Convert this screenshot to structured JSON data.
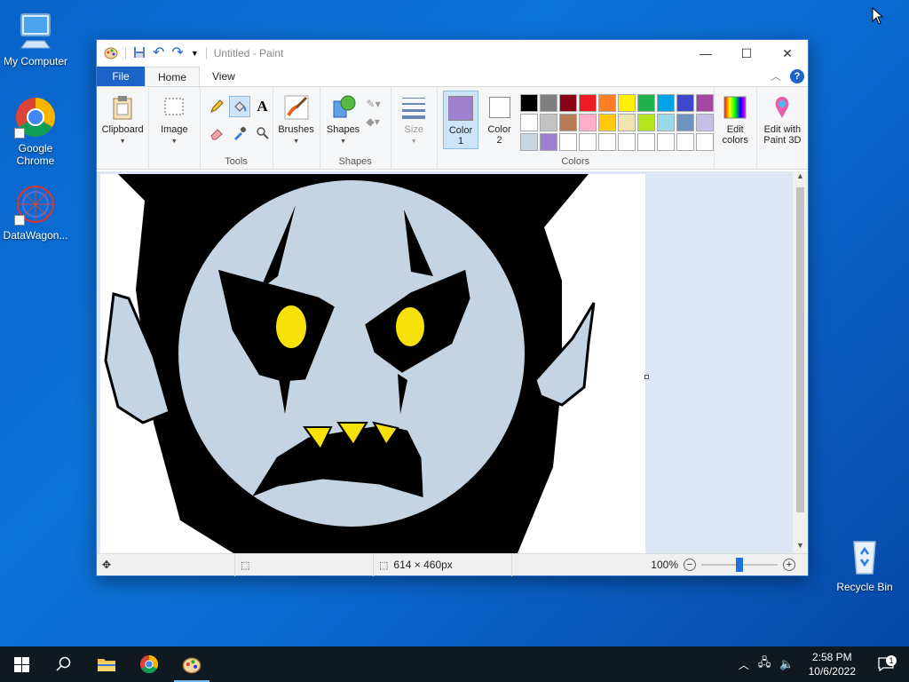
{
  "desktop": {
    "icons": [
      {
        "label": "My Computer"
      },
      {
        "label": "Google Chrome"
      },
      {
        "label": "DataWagon..."
      },
      {
        "label": "Recycle Bin"
      }
    ]
  },
  "window": {
    "title": "Untitled - Paint",
    "tabs": {
      "file": "File",
      "home": "Home",
      "view": "View"
    },
    "help": "?"
  },
  "ribbon": {
    "clipboard": {
      "label": "Clipboard"
    },
    "image": {
      "label": "Image"
    },
    "tools": {
      "group_label": "Tools",
      "text_tool": "A"
    },
    "brushes": {
      "label": "Brushes"
    },
    "shapes": {
      "label": "Shapes",
      "group_label": "Shapes"
    },
    "size": {
      "label": "Size"
    },
    "color1": {
      "label": "Color\n1",
      "line1": "Color",
      "line2": "1",
      "value": "#a07fcf"
    },
    "color2": {
      "line1": "Color",
      "line2": "2",
      "value": "#ffffff"
    },
    "colors_group_label": "Colors",
    "palette": [
      "#000000",
      "#7f7f7f",
      "#880015",
      "#ed1c24",
      "#ff7f27",
      "#fff200",
      "#22b14c",
      "#00a2e8",
      "#3f48cc",
      "#a349a4",
      "#ffffff",
      "#c3c3c3",
      "#b97a57",
      "#ffaec9",
      "#ffc90e",
      "#efe4b0",
      "#b5e61d",
      "#99d9ea",
      "#7092be",
      "#c8bfe7",
      "#c8d7e3",
      "#a07fcf",
      "#ffffff",
      "#ffffff",
      "#ffffff",
      "#ffffff",
      "#ffffff",
      "#ffffff",
      "#ffffff",
      "#ffffff"
    ],
    "edit_colors": {
      "line1": "Edit",
      "line2": "colors"
    },
    "paint3d": {
      "line1": "Edit with",
      "line2": "Paint 3D"
    }
  },
  "statusbar": {
    "dimensions": "614 × 460px",
    "zoom": "100%",
    "zoom_level": 0.5
  },
  "taskbar": {
    "time": "2:58 PM",
    "date": "10/6/2022",
    "notifications": "1"
  }
}
